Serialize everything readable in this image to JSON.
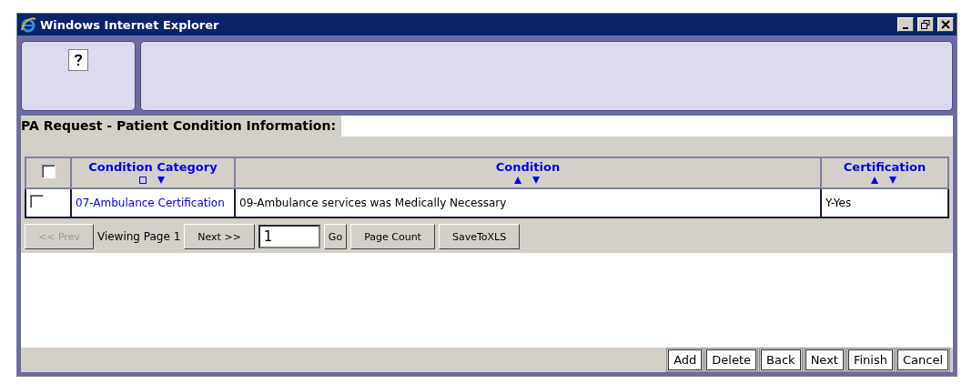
{
  "window": {
    "title": "Windows Internet Explorer"
  },
  "heading": "PA Request - Patient Condition Information:",
  "table": {
    "select_all": {
      "checked": false
    },
    "columns": [
      {
        "label": "Condition Category",
        "sorted": true
      },
      {
        "label": "Condition",
        "sorted": false
      },
      {
        "label": "Certification",
        "sorted": false
      }
    ],
    "rows": [
      {
        "checked": false,
        "cells": [
          "07-Ambulance Certification",
          "09-Ambulance services was Medically Necessary",
          "Y-Yes"
        ]
      }
    ]
  },
  "pager": {
    "prev": {
      "label": "<< Prev",
      "disabled": true
    },
    "viewing": "Viewing Page 1",
    "next": {
      "label": "Next >>",
      "disabled": false
    },
    "page_value": "1",
    "go": "Go",
    "page_count": "Page Count",
    "export": "SaveToXLS"
  },
  "buttons": [
    "Add",
    "Delete",
    "Back",
    "Next",
    "Finish",
    "Cancel"
  ]
}
